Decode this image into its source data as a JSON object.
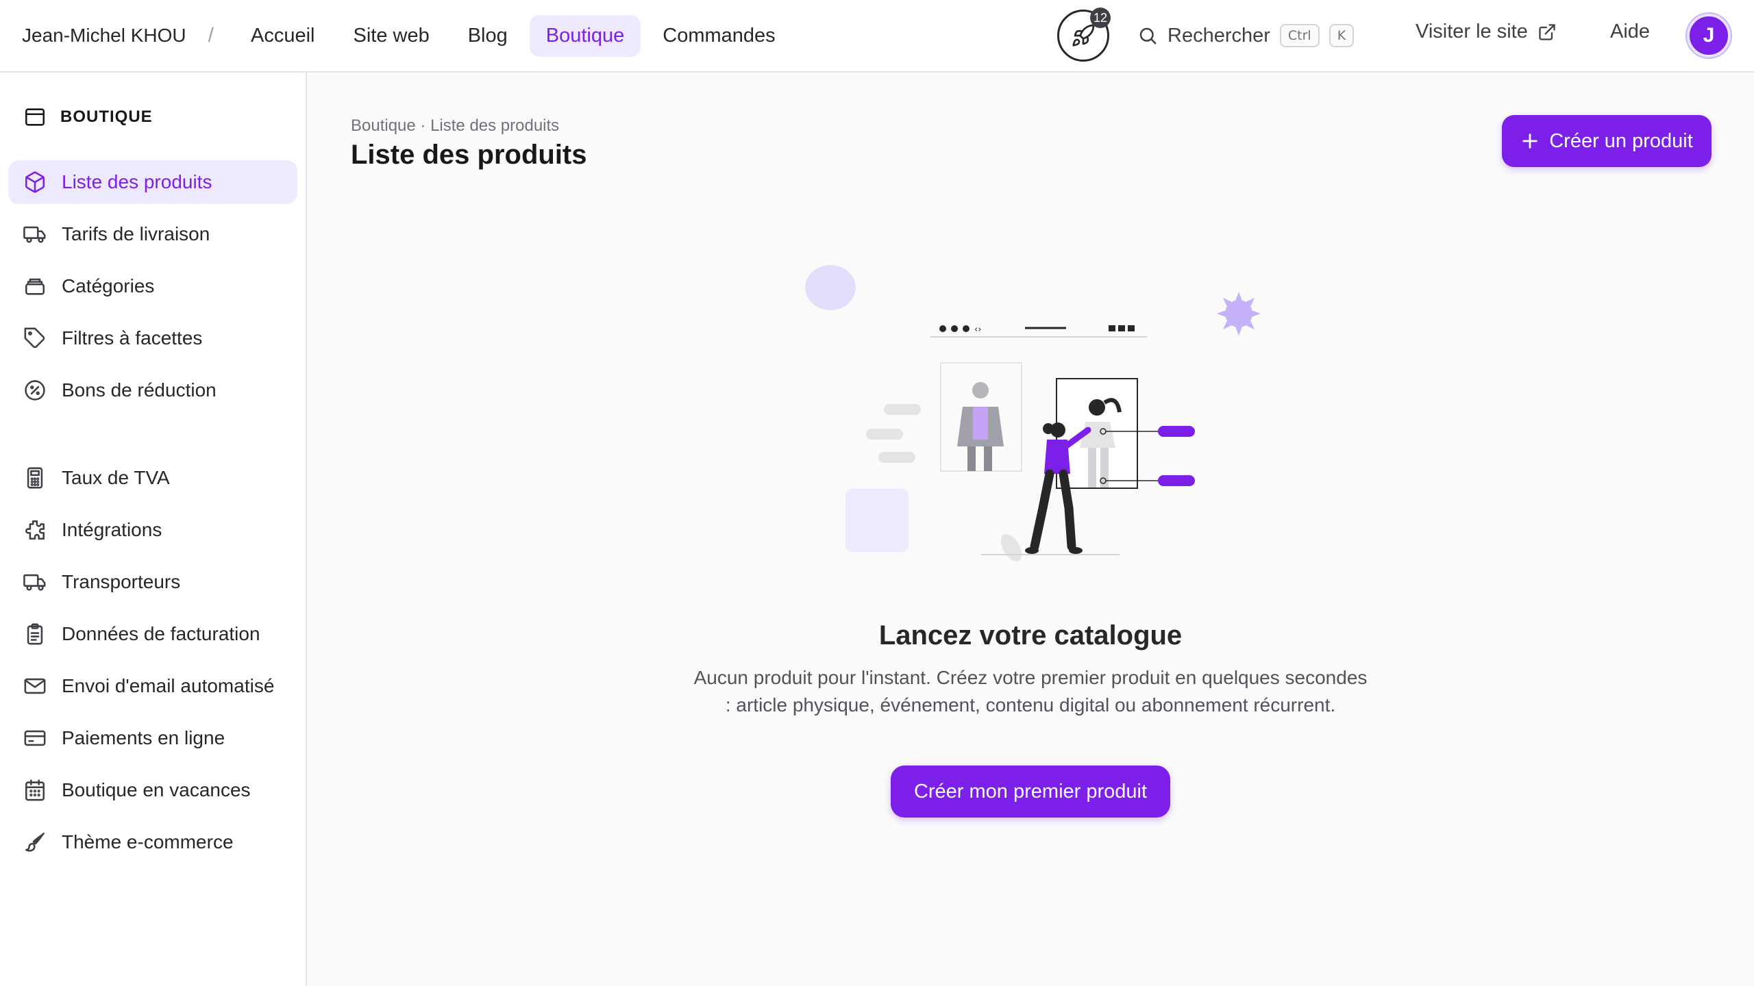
{
  "header": {
    "owner": "Jean-Michel KHOU",
    "separator": "/",
    "nav": [
      {
        "label": "Accueil"
      },
      {
        "label": "Site web"
      },
      {
        "label": "Blog"
      },
      {
        "label": "Boutique",
        "active": true
      },
      {
        "label": "Commandes"
      }
    ],
    "notification_count": "12",
    "search_label": "Rechercher",
    "shortcut_keys": [
      "Ctrl",
      "K"
    ],
    "visit_label": "Visiter le site",
    "help_label": "Aide",
    "avatar_initial": "J"
  },
  "sidebar": {
    "section_title": "BOUTIQUE",
    "items": [
      {
        "label": "Liste des produits",
        "icon": "box-icon",
        "active": true
      },
      {
        "label": "Tarifs de livraison",
        "icon": "truck-icon"
      },
      {
        "label": "Catégories",
        "icon": "layers-icon"
      },
      {
        "label": "Filtres à facettes",
        "icon": "tag-icon"
      },
      {
        "label": "Bons de réduction",
        "icon": "discount-icon"
      },
      {
        "label": "Taux de TVA",
        "icon": "calculator-icon"
      },
      {
        "label": "Intégrations",
        "icon": "puzzle-icon"
      },
      {
        "label": "Transporteurs",
        "icon": "truck-icon"
      },
      {
        "label": "Données de facturation",
        "icon": "clipboard-icon"
      },
      {
        "label": "Envoi d'email automatisé",
        "icon": "mail-icon"
      },
      {
        "label": "Paiements en ligne",
        "icon": "credit-card-icon"
      },
      {
        "label": "Boutique en vacances",
        "icon": "calendar-icon"
      },
      {
        "label": "Thème e-commerce",
        "icon": "brush-icon"
      }
    ]
  },
  "main": {
    "breadcrumb": "Boutique · Liste des produits",
    "title": "Liste des produits",
    "create_button": "Créer un produit",
    "empty_title": "Lancez votre catalogue",
    "empty_description": "Aucun produit pour l'instant. Créez votre premier produit en quelques secondes : article physique, événement, contenu digital ou abonnement récurrent.",
    "empty_button": "Créer mon premier produit"
  },
  "colors": {
    "accent": "#7c1fe8",
    "accent_soft": "#ede9fe",
    "background": "#fafafa"
  }
}
